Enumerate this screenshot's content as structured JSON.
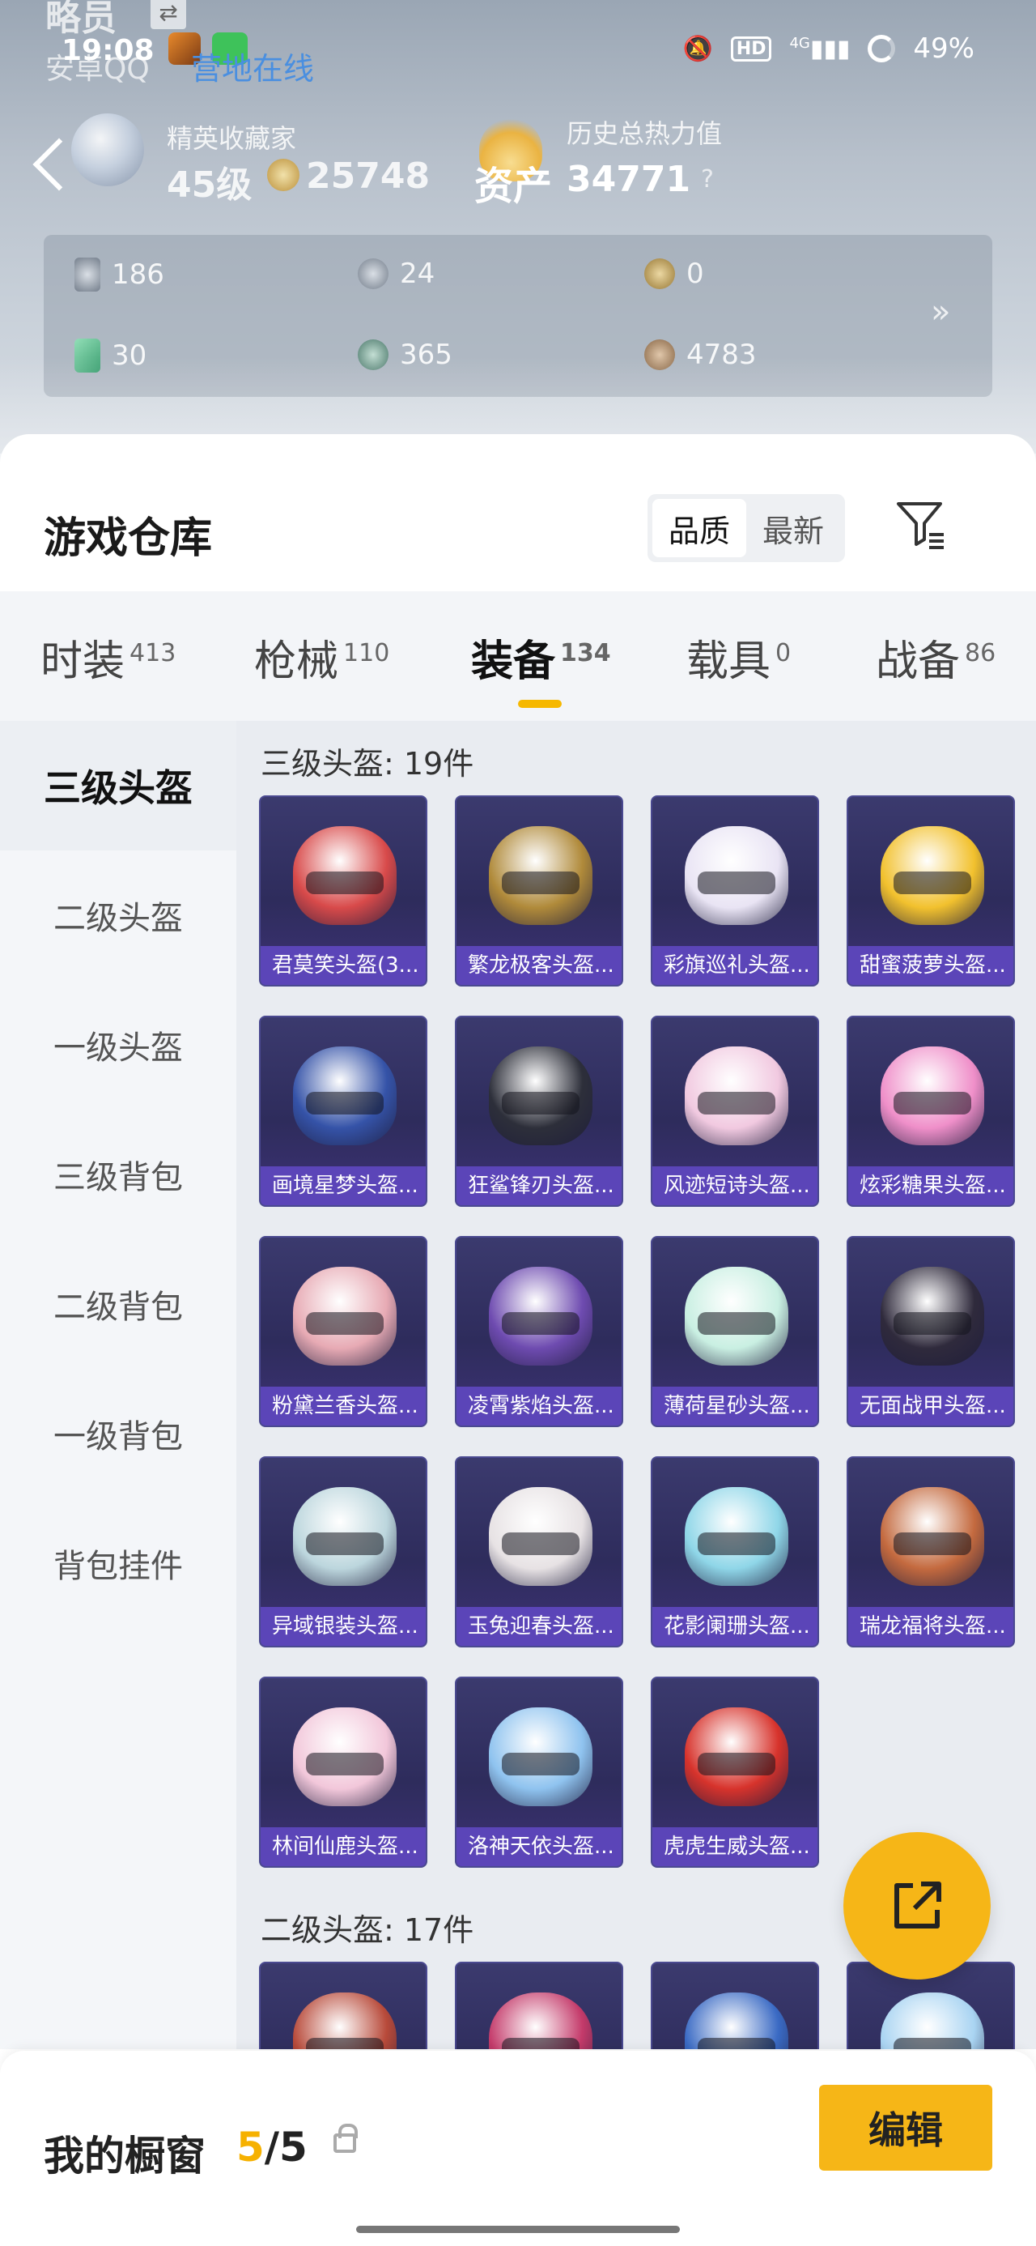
{
  "status_bar": {
    "time": "19:08",
    "player_name": "略员",
    "server_text": "安卓QQ",
    "online_text": "营地在线",
    "battery": "49%",
    "hd_badge": "HD",
    "signal_label": "4G"
  },
  "profile": {
    "rank_title": "精英收藏家",
    "rank_level": "45级",
    "rank_points": "25748",
    "assets_label": "资产",
    "heat_title": "历史总热力值",
    "heat_value": "34771",
    "help": "?"
  },
  "stats": [
    {
      "value": "186",
      "icon": "card-icon"
    },
    {
      "value": "24",
      "icon": "silver-coin-icon"
    },
    {
      "value": "0",
      "icon": "gold-coin-icon"
    },
    {
      "value": "30",
      "icon": "green-card-icon"
    },
    {
      "value": "365",
      "icon": "teal-coin-icon"
    },
    {
      "value": "4783",
      "icon": "bronze-coin-icon"
    }
  ],
  "stats_more": "»",
  "warehouse": {
    "title": "游戏仓库",
    "sort_options": [
      "品质",
      "最新"
    ],
    "sort_selected": "品质"
  },
  "tabs": [
    {
      "label": "时装",
      "count": "413"
    },
    {
      "label": "枪械",
      "count": "110"
    },
    {
      "label": "装备",
      "count": "134"
    },
    {
      "label": "载具",
      "count": "0"
    },
    {
      "label": "战备",
      "count": "86"
    }
  ],
  "active_tab": "装备",
  "sidebar": [
    "三级头盔",
    "二级头盔",
    "一级头盔",
    "三级背包",
    "二级背包",
    "一级背包",
    "背包挂件"
  ],
  "sections": [
    {
      "title": "三级头盔: 19件",
      "items": [
        {
          "name": "君莫笑头盔(3...",
          "color": "#d84a4a"
        },
        {
          "name": "繁龙极客头盔...",
          "color": "#b08a3a"
        },
        {
          "name": "彩旗巡礼头盔...",
          "color": "#e9e4f4"
        },
        {
          "name": "甜蜜菠萝头盔...",
          "color": "#f2c12e"
        },
        {
          "name": "画境星梦头盔...",
          "color": "#3553a8"
        },
        {
          "name": "狂鲨锋刃头盔...",
          "color": "#2d2f3a"
        },
        {
          "name": "风迹短诗头盔...",
          "color": "#f1c9e0"
        },
        {
          "name": "炫彩糖果头盔...",
          "color": "#ef8fc9"
        },
        {
          "name": "粉黛兰香头盔...",
          "color": "#e7aab4"
        },
        {
          "name": "凌霄紫焰头盔...",
          "color": "#6e4bb0"
        },
        {
          "name": "薄荷星砂头盔...",
          "color": "#c9efe2"
        },
        {
          "name": "无面战甲头盔...",
          "color": "#2f2a3c"
        },
        {
          "name": "异域银装头盔...",
          "color": "#bcd6dd"
        },
        {
          "name": "玉兔迎春头盔...",
          "color": "#e7e2e4"
        },
        {
          "name": "花影阑珊头盔...",
          "color": "#8fd6e8"
        },
        {
          "name": "瑞龙福将头盔...",
          "color": "#c46a3f"
        },
        {
          "name": "林间仙鹿头盔...",
          "color": "#f2c7da"
        },
        {
          "name": "洛神天依头盔...",
          "color": "#8fc3ef"
        },
        {
          "name": "虎虎生威头盔...",
          "color": "#d7332c"
        }
      ]
    },
    {
      "title": "二级头盔: 17件",
      "items": [
        {
          "name": "",
          "color": "#b84a3a"
        },
        {
          "name": "",
          "color": "#c43a6a"
        },
        {
          "name": "",
          "color": "#3a6ac4"
        },
        {
          "name": "",
          "color": "#a9d4f2"
        }
      ]
    }
  ],
  "showcase": {
    "label": "我的橱窗",
    "current": "5",
    "total": "/5",
    "edit_label": "编辑"
  },
  "colors": {
    "accent": "#f6b617",
    "card_bg": "#2e2c5c",
    "card_name_bg": "#5b45b8"
  }
}
